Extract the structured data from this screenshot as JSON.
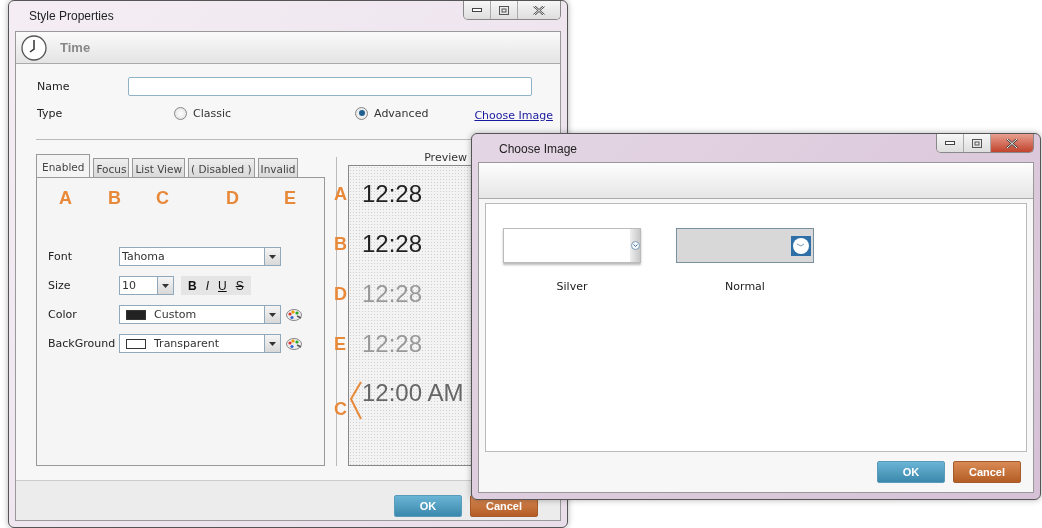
{
  "main_window": {
    "title": "Style Properties",
    "header": "Time",
    "name_label": "Name",
    "type_label": "Type",
    "type_options": [
      {
        "label": "Classic",
        "selected": false
      },
      {
        "label": "Advanced",
        "selected": true
      }
    ],
    "choose_image_link": "Choose Image",
    "tabs": [
      {
        "label": "Enabled",
        "selected": true
      },
      {
        "label": "Focus",
        "selected": false
      },
      {
        "label": "List View",
        "selected": false
      },
      {
        "label": "( Disabled )",
        "selected": false
      },
      {
        "label": "Invalid",
        "selected": false
      }
    ],
    "state_letters": [
      "A",
      "B",
      "C",
      "D",
      "E"
    ],
    "fields": [
      {
        "kind": "dropdown",
        "label": "Font",
        "value": "Tahoma"
      },
      {
        "kind": "size",
        "label": "Size",
        "value": "10",
        "format_buttons": [
          {
            "label": "B",
            "kind": "bold"
          },
          {
            "label": "I",
            "kind": "italic"
          },
          {
            "label": "U",
            "kind": "underline"
          },
          {
            "label": "S",
            "kind": "strike"
          }
        ]
      },
      {
        "kind": "swatch",
        "label": "Color",
        "value": "Custom",
        "color": "#222222"
      },
      {
        "kind": "swatch",
        "label": "BackGround",
        "value": "Transparent",
        "color": "#ffffff"
      }
    ],
    "preview": {
      "title": "Preview",
      "rows": [
        {
          "letter": "A",
          "time": "12:28",
          "kind": "dark"
        },
        {
          "letter": "B",
          "time": "12:28",
          "kind": "dark"
        },
        {
          "letter": "D",
          "time": "12:28",
          "kind": "faded"
        },
        {
          "letter": "E",
          "time": "12:28",
          "kind": "faded"
        },
        {
          "letter": "C",
          "time": "12:00 AM",
          "kind": "medium"
        }
      ]
    },
    "buttons": [
      {
        "label": "OK",
        "kind": "primary"
      },
      {
        "label": "Cancel",
        "kind": "secondary"
      }
    ]
  },
  "dialog": {
    "title": "Choose Image",
    "images": [
      {
        "label": "Silver",
        "kind": "silver"
      },
      {
        "label": "Normal",
        "kind": "normal"
      }
    ],
    "buttons": [
      {
        "label": "OK",
        "kind": "primary"
      },
      {
        "label": "Cancel",
        "kind": "secondary"
      }
    ]
  }
}
